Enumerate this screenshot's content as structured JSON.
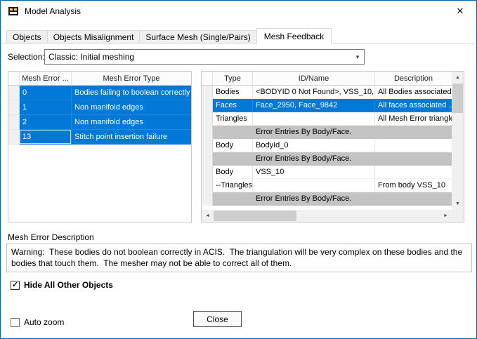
{
  "window": {
    "title": "Model Analysis"
  },
  "icons": {
    "close": "✕",
    "chevron_down": "▾",
    "check": "✓",
    "scroll_up": "▲",
    "scroll_down": "▼",
    "scroll_left": "◄",
    "scroll_right": "►"
  },
  "tabs": [
    {
      "label": "Objects",
      "active": false
    },
    {
      "label": "Objects Misalignment",
      "active": false
    },
    {
      "label": "Surface Mesh (Single/Pairs)",
      "active": false
    },
    {
      "label": "Mesh Feedback",
      "active": true
    }
  ],
  "selection": {
    "label": "Selection:",
    "value": "Classic: Initial meshing"
  },
  "left_table": {
    "headers": {
      "id": "Mesh Error ...",
      "type": "Mesh Error Type"
    },
    "rows": [
      {
        "id": "0",
        "type": "Bodies failing to boolean correctly",
        "selected": true
      },
      {
        "id": "1",
        "type": "Non manifold edges",
        "selected": true
      },
      {
        "id": "2",
        "type": "Non manifold edges",
        "selected": true
      },
      {
        "id": "13",
        "type": "Stitch point insertion failure",
        "selected": true
      }
    ]
  },
  "right_table": {
    "headers": {
      "type": "Type",
      "id_name": "ID/Name",
      "description": "Description"
    },
    "rows": [
      {
        "type": "Bodies",
        "id_name": "<BODYID 0 Not Found>, VSS_10,...",
        "description": "All Bodies associated",
        "style": "normal"
      },
      {
        "type": "Faces",
        "id_name": "Face_2950, Face_9842",
        "description": "All faces associated ..",
        "style": "selected"
      },
      {
        "type": "Triangles",
        "id_name": "",
        "description": "All Mesh Error triangle.",
        "style": "normal"
      },
      {
        "type": "",
        "id_name": "Error Entries By Body/Face.",
        "description": "",
        "style": "gray"
      },
      {
        "type": "Body",
        "id_name": "BodyId_0",
        "description": "",
        "style": "normal"
      },
      {
        "type": "",
        "id_name": "Error Entries By Body/Face.",
        "description": "",
        "style": "gray"
      },
      {
        "type": "Body",
        "id_name": "VSS_10",
        "description": "",
        "style": "normal"
      },
      {
        "type": "--Triangles",
        "id_name": "",
        "description": "From body VSS_10",
        "style": "normal"
      },
      {
        "type": "",
        "id_name": "Error Entries By Body/Face.",
        "description": "",
        "style": "gray"
      }
    ]
  },
  "description_section": {
    "label": "Mesh Error Description",
    "text": "Warning:  These bodies do not boolean correctly in ACIS.  The triangulation will be very complex on these bodies and the bodies that touch them.  The mesher may not be able to correct all of them."
  },
  "checkboxes": {
    "hide_all": {
      "label": "Hide All Other Objects",
      "checked": true
    },
    "auto_zoom": {
      "label": "Auto zoom",
      "checked": false
    }
  },
  "buttons": {
    "close": "Close"
  },
  "colors": {
    "selection_blue": "#0078d7",
    "gray_row": "#c3c3c3",
    "window_border": "#0063b1"
  }
}
